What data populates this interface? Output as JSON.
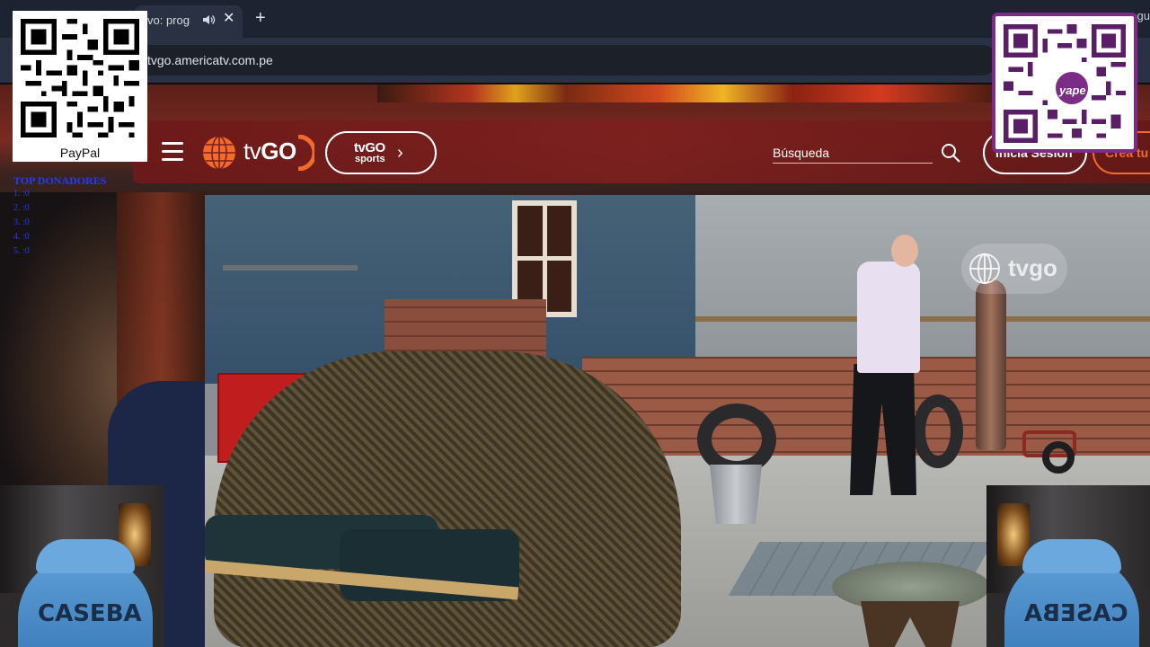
{
  "browser": {
    "tab_title": "vo: progra",
    "tab_close": "✕",
    "new_tab": "+",
    "tabstrip_right": "gu",
    "url": "tvgo.americatv.com.pe"
  },
  "site": {
    "logo_prefix": "tv",
    "logo_bold": "GO",
    "sports_top": "tvGO",
    "sports_bottom": "sports",
    "sports_chevron": "›",
    "search_placeholder": "Búsqueda",
    "login_label": "Inicia Sesión",
    "create_label": "Crea tu",
    "accent_color": "#f26b2a",
    "header_color": "#7a1f1e"
  },
  "video": {
    "watermark": "tvgo"
  },
  "overlays": {
    "paypal_label": "PayPal",
    "donors_title": "TOP DONADORES",
    "donors": [
      "1. :0",
      "2. :0",
      "3. :0",
      "4. :0",
      "5. :0"
    ],
    "yape_label": "yape",
    "webcam_text": "CASEBA"
  }
}
